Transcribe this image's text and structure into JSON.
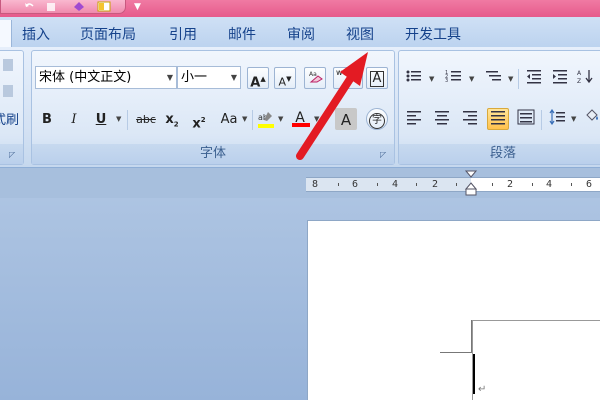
{
  "tabs": [
    {
      "label": "插入"
    },
    {
      "label": "页面布局"
    },
    {
      "label": "引用"
    },
    {
      "label": "邮件"
    },
    {
      "label": "审阅"
    },
    {
      "label": "视图"
    },
    {
      "label": "开发工具"
    }
  ],
  "font_group": {
    "font_name": "宋体 (中文正文)",
    "font_size": "小一",
    "label": "字体",
    "grow_font_icon": "A",
    "shrink_font_icon": "A",
    "bold": "B",
    "italic": "I",
    "underline": "U",
    "strikethrough": "abc",
    "subscript": "x",
    "subscript_mark": "2",
    "superscript": "x",
    "superscript_mark": "2",
    "change_case": "Aa",
    "font_color": "A",
    "char_shading": "A",
    "char_border": "A",
    "enclose_char": "字",
    "phonetic": "wén"
  },
  "paragraph_group": {
    "label": "段落"
  },
  "left_fragment": {
    "label": "式刷"
  },
  "ruler": {
    "ticks": [
      "8",
      "6",
      "4",
      "2",
      "2",
      "4",
      "6"
    ]
  },
  "colors": {
    "title_bar": "#e65a8b",
    "ribbon_bg": "#dbe7f6",
    "highlight_color": "#ffff00",
    "font_color_bar": "#ff0000",
    "arrow": "#e31b23",
    "workspace": "#a7bfdd"
  }
}
